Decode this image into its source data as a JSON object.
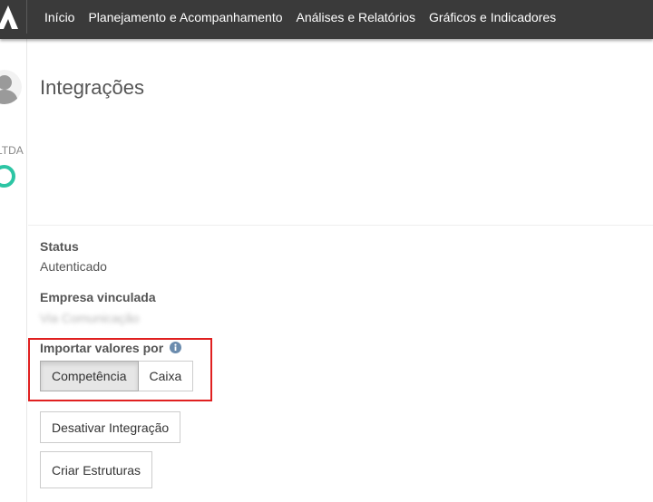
{
  "nav": {
    "items": [
      "Início",
      "Planejamento e Acompanhamento",
      "Análises e Relatórios",
      "Gráficos e Indicadores"
    ]
  },
  "sidebar": {
    "company_label": "LTDA",
    "accent_color": "#2cc5a4"
  },
  "page": {
    "title": "Integrações"
  },
  "status": {
    "label": "Status",
    "value": "Autenticado"
  },
  "company": {
    "label": "Empresa vinculada",
    "value": "Via Comunicação"
  },
  "import": {
    "label": "Importar valores por",
    "options": [
      "Competência",
      "Caixa"
    ],
    "selected": "Competência"
  },
  "actions": {
    "deactivate_label": "Desativar Integração",
    "create_label": "Criar Estruturas"
  },
  "colors": {
    "topbar": "#3a3a3a",
    "highlight": "#e02020",
    "info_icon": "#6b8cae"
  }
}
